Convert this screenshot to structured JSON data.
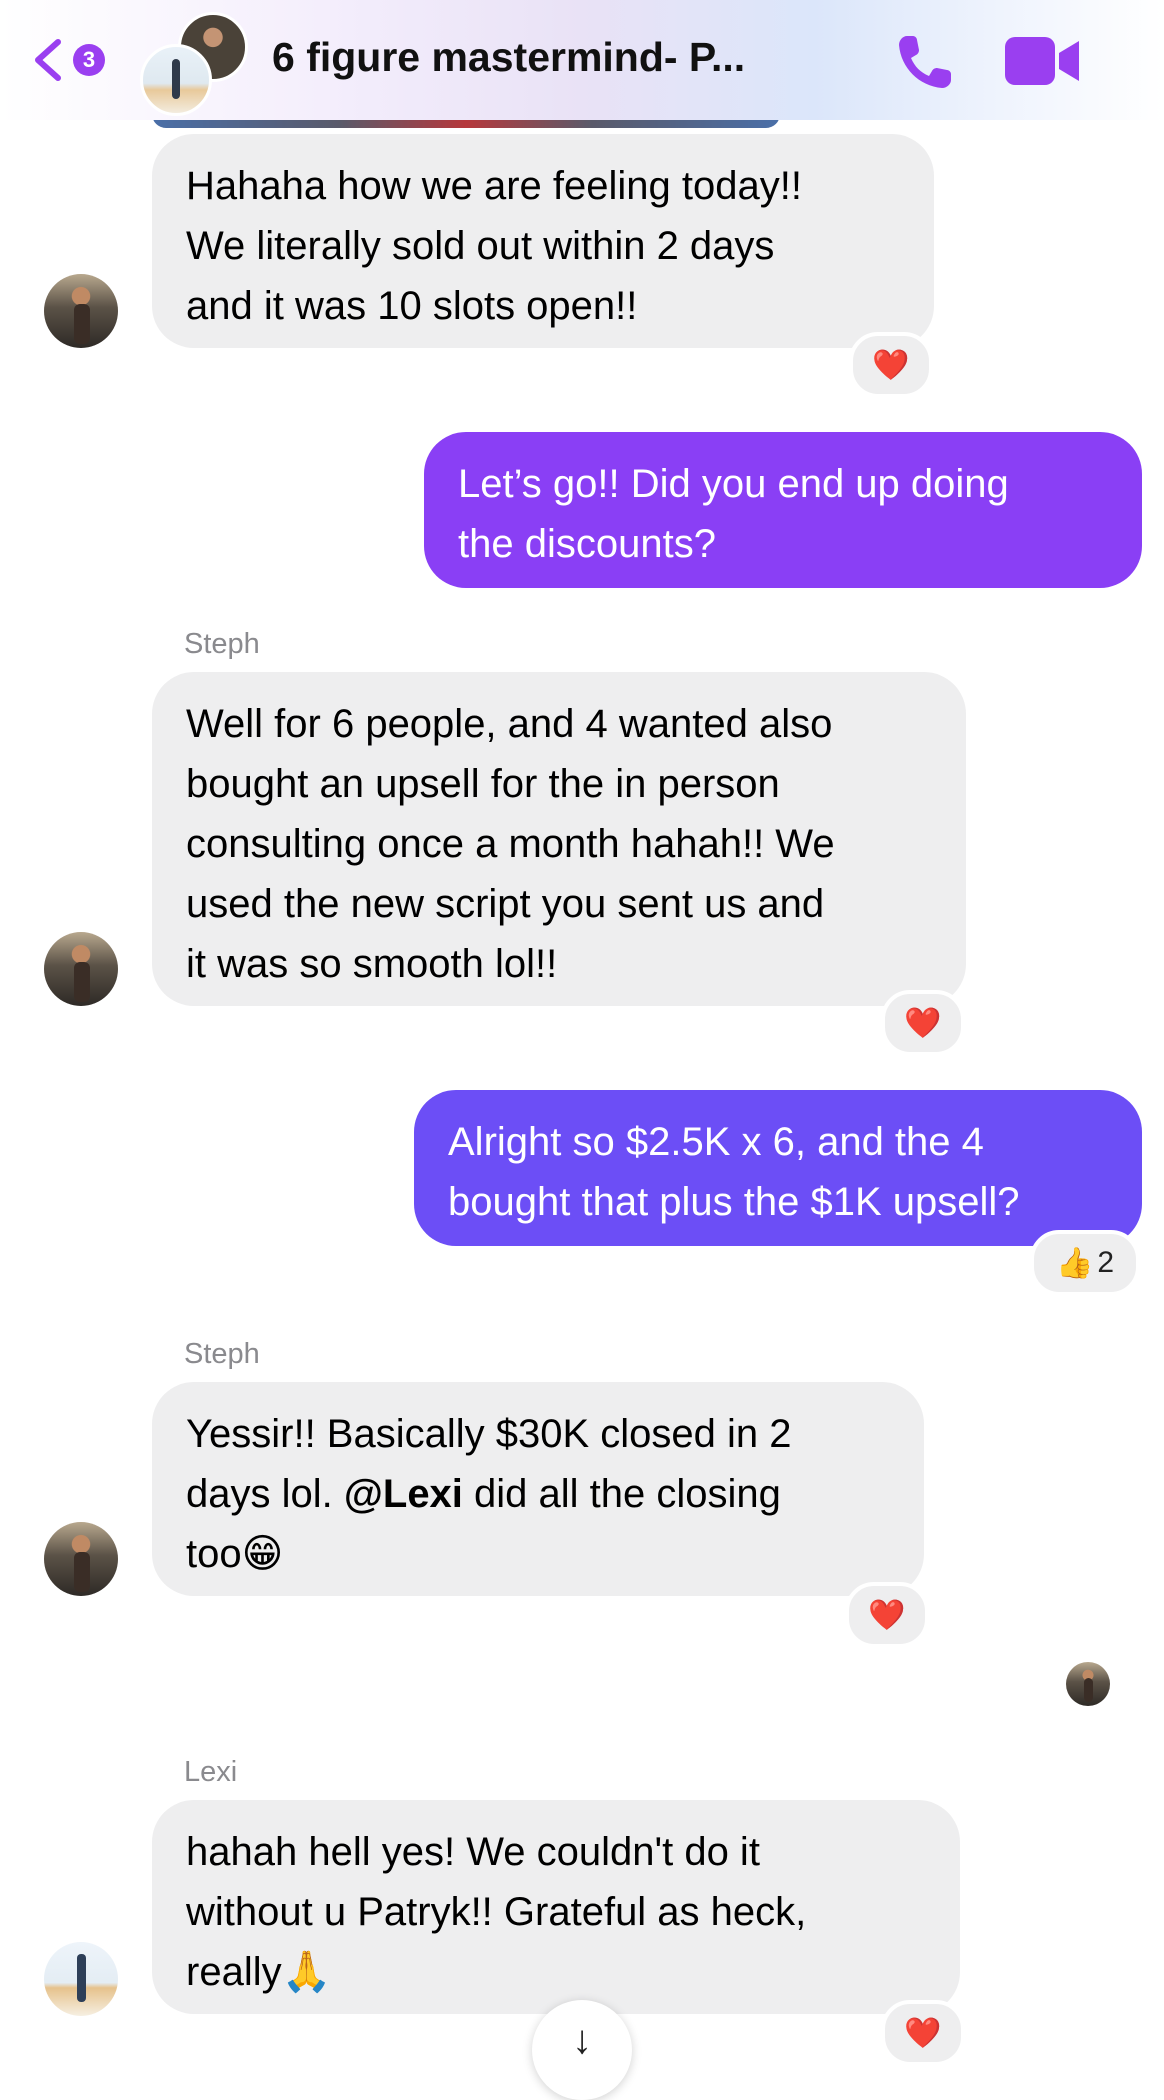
{
  "header": {
    "unread_count": "3",
    "title": "6 figure mastermind- P..."
  },
  "messages": [
    {
      "sender": "",
      "direction": "incoming",
      "lines": [
        "Hahaha how we are feeling today!!",
        "We literally sold out within 2 days",
        "and it was 10 slots open!!"
      ],
      "reaction": "❤️"
    },
    {
      "direction": "outgoing",
      "lines": [
        "Let’s go!! Did you end up doing",
        "the discounts?"
      ]
    },
    {
      "sender": "Steph",
      "direction": "incoming",
      "lines": [
        "Well for 6 people, and 4 wanted also",
        "bought an upsell for the in person",
        "consulting once a month hahah!! We",
        "used the new script you sent us and",
        "it was so smooth lol!!"
      ],
      "reaction": "❤️"
    },
    {
      "direction": "outgoing",
      "lines": [
        "Alright so $2.5K x 6, and the 4",
        "bought that plus the $1K upsell?"
      ],
      "reaction": "👍",
      "reaction_count": "2"
    },
    {
      "sender": "Steph",
      "direction": "incoming",
      "lines": [
        "Yessir!! Basically $30K closed in 2",
        "days lol.",
        "@Lexi",
        "did all the closing",
        "too😁"
      ],
      "reaction": "❤️"
    },
    {
      "sender": "Lexi",
      "direction": "incoming",
      "lines": [
        "hahah hell yes! We couldn't do it",
        "without u Patryk!!  Grateful as heck,",
        "really🙏"
      ],
      "reaction": "❤️"
    }
  ],
  "scroll_button": "↓",
  "colors": {
    "outgoing_1": "#8a3ff5",
    "outgoing_2": "#6c4ef6",
    "incoming_bg": "#eeeeef",
    "accent": "#9a3ff0"
  }
}
